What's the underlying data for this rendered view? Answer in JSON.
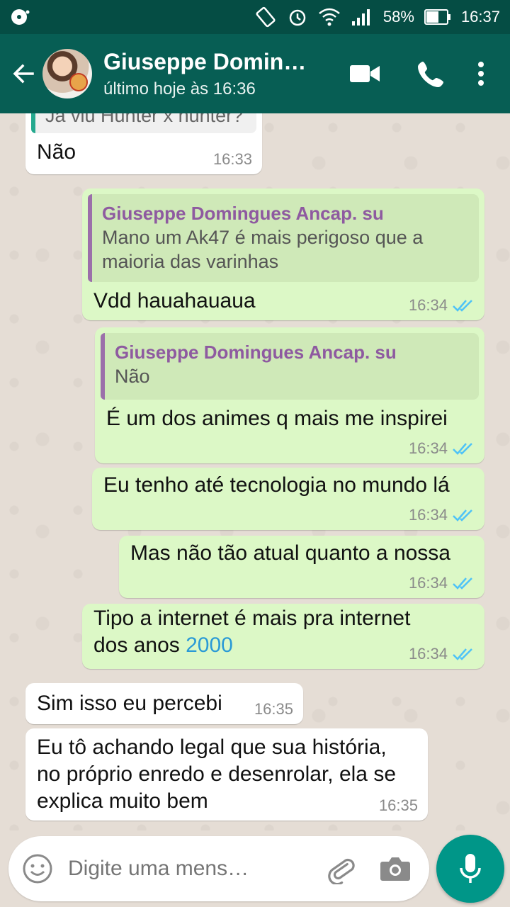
{
  "status_bar": {
    "battery": "58%",
    "time": "16:37"
  },
  "header": {
    "contact_name": "Giuseppe Domin…",
    "last_seen": "último hoje às 16:36"
  },
  "messages": [
    {
      "partial_quote": "Já viu Hunter x hunter?",
      "text": "Não",
      "time": "16:33"
    },
    {
      "quote_author": "Giuseppe Domingues Ancap. su",
      "quote_text_1": "Mano um Ak47 é mais perigoso que a",
      "quote_text_2": "maioria das varinhas",
      "text": "Vdd hauahauaua",
      "time": "16:34"
    },
    {
      "quote_author": "Giuseppe Domingues Ancap. su",
      "quote_text": "Não",
      "text": "É um dos animes q mais me inspirei",
      "time": "16:34"
    },
    {
      "text": "Eu tenho até tecnologia no mundo lá",
      "time": "16:34"
    },
    {
      "text": "Mas não tão atual quanto a nossa",
      "time": "16:34"
    },
    {
      "text_1": "Tipo a internet é mais pra internet",
      "text_2a": "dos anos ",
      "text_2b": "2000",
      "time": "16:34"
    },
    {
      "text": "Sim isso eu percebi",
      "time": "16:35"
    },
    {
      "text_1": "Eu tô achando legal que sua história,",
      "text_2": "no próprio enredo e desenrolar, ela se",
      "text_3": "explica muito bem",
      "time": "16:35"
    }
  ],
  "input": {
    "placeholder": "Digite uma mens…"
  },
  "colors": {
    "header": "#075e54",
    "status_bar": "#054d44",
    "outgoing_bubble": "#dcf8c6",
    "incoming_bubble": "#ffffff",
    "read_ticks": "#4fc3f7",
    "mic_button": "#009688"
  }
}
